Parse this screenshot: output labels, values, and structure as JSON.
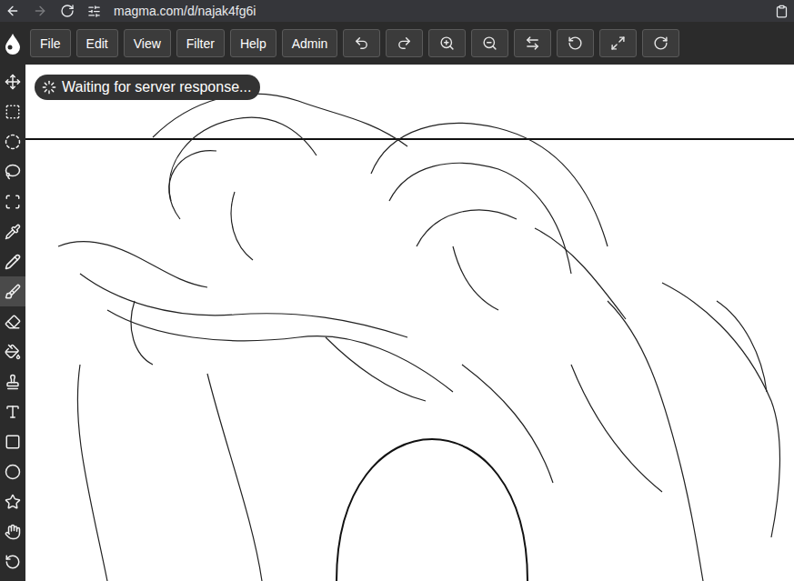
{
  "browser": {
    "url": "magma.com/d/najak4fg6i",
    "back_disabled": false,
    "forward_disabled": true
  },
  "menu": [
    {
      "label": "File"
    },
    {
      "label": "Edit"
    },
    {
      "label": "View"
    },
    {
      "label": "Filter"
    },
    {
      "label": "Help"
    },
    {
      "label": "Admin"
    }
  ],
  "actions": [
    {
      "disabled": false
    },
    {
      "disabled": false
    },
    {
      "disabled": false
    },
    {
      "disabled": false
    },
    {
      "disabled": false
    },
    {
      "disabled": false
    },
    {
      "disabled": false
    },
    {
      "disabled": false
    }
  ],
  "tools": [
    {
      "selected": false
    },
    {
      "selected": false
    },
    {
      "selected": false
    },
    {
      "selected": false
    },
    {
      "selected": false
    },
    {
      "selected": false
    },
    {
      "selected": false
    },
    {
      "selected": true
    },
    {
      "selected": false
    },
    {
      "selected": false
    },
    {
      "selected": false
    },
    {
      "selected": false
    },
    {
      "selected": false
    },
    {
      "selected": false
    },
    {
      "selected": false
    },
    {
      "selected": false
    },
    {
      "selected": false
    }
  ],
  "status": {
    "text": "Waiting for server response..."
  }
}
